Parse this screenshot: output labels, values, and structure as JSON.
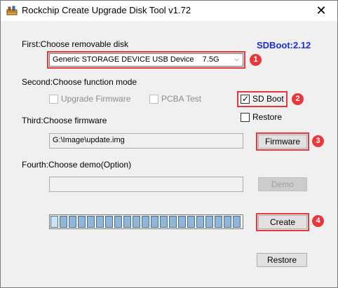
{
  "window": {
    "title": "Rockchip Create Upgrade Disk Tool v1.72",
    "close_glyph": "✕"
  },
  "sdboot_version": "SDBoot:2.12",
  "step1": {
    "label": "First:Choose removable disk",
    "disk_device": "Generic STORAGE DEVICE USB Device",
    "disk_size": "7.5G",
    "badge": "1"
  },
  "step2": {
    "label": "Second:Choose function mode",
    "upgrade_firmware": {
      "label": "Upgrade Firmware",
      "checked": false,
      "enabled": false
    },
    "pcba_test": {
      "label": "PCBA Test",
      "checked": false,
      "enabled": false
    },
    "sd_boot": {
      "label": "SD Boot",
      "checked": true,
      "enabled": true
    },
    "restore": {
      "label": "Restore",
      "checked": false,
      "enabled": true
    },
    "badge": "2"
  },
  "step3": {
    "label": "Third:Choose firmware",
    "firmware_path": "G:\\Image\\update.img",
    "firmware_button": "Firmware",
    "badge": "3"
  },
  "step4": {
    "label": "Fourth:Choose demo(Option)",
    "demo_path": "",
    "demo_button": "Demo",
    "badge": "4"
  },
  "progress": {
    "total_segments": 21,
    "highlighted_segments": 1
  },
  "buttons": {
    "create": "Create",
    "restore": "Restore"
  },
  "colors": {
    "annotation_red": "#e8383d",
    "sdboot_blue": "#1a2ce0"
  }
}
